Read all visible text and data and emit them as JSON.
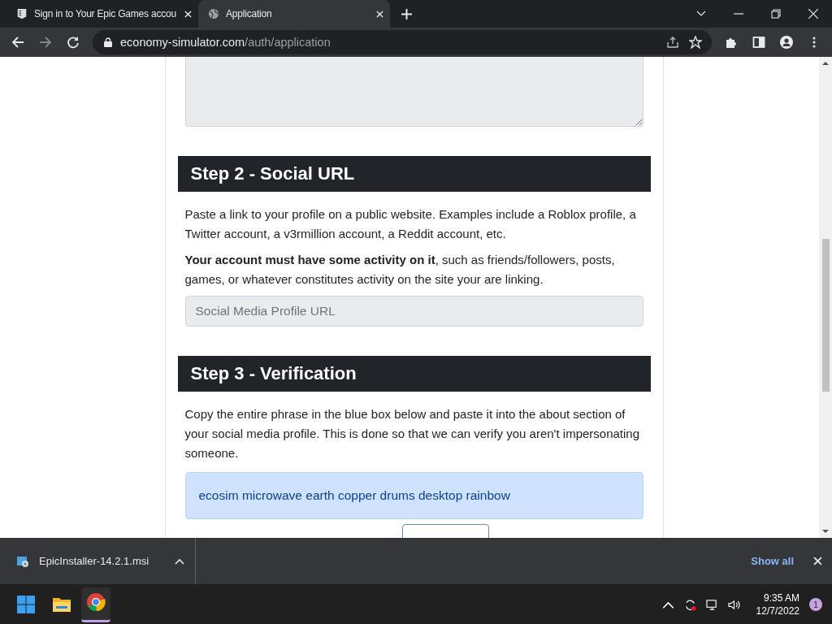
{
  "tabs": [
    {
      "title": "Sign in to Your Epic Games accou",
      "kind": "epic",
      "selected": false
    },
    {
      "title": "Application",
      "kind": "globe",
      "selected": true
    }
  ],
  "address_bar": {
    "domain": "economy-simulator.com",
    "path": "/auth/application"
  },
  "sections": [
    {
      "heading": "Step 2 - Social URL",
      "paragraphs": [
        "Paste a link to your profile on a public website. Examples include a Roblox profile, a Twitter account, a v3rmillion account, a Reddit account, etc.",
        "**Your account must have some activity on it**, such as friends/followers, posts, games, or whatever constitutes activity on the site your are linking."
      ],
      "field": {
        "placeholder": "Social Media Profile URL"
      }
    },
    {
      "heading": "Step 3 - Verification",
      "paragraphs": [
        "Copy the entire phrase in the blue box below and paste it into the about section of your social media profile. This is done so that we can verify you aren't impersonating someone."
      ],
      "phrase": "ecosim microwave earth copper drums desktop rainbow"
    }
  ],
  "download_bar": {
    "file": "EpicInstaller-14.2.1.msi",
    "show_all": "Show all"
  },
  "taskbar": {
    "time": "9:35 AM",
    "date": "12/7/2022",
    "notifications": "1"
  }
}
